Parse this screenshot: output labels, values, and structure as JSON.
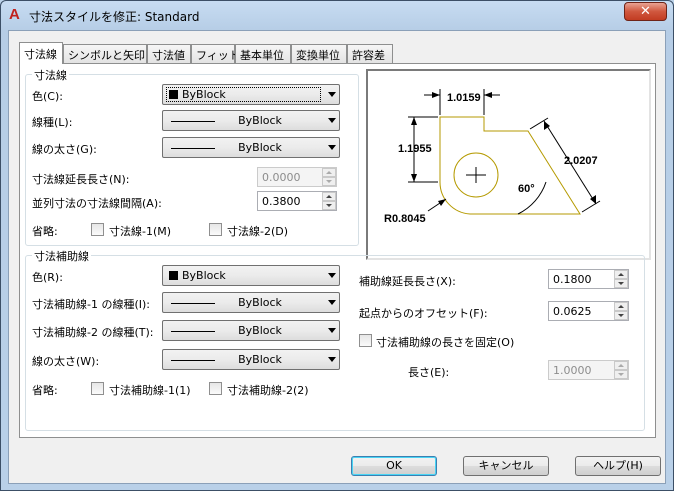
{
  "window": {
    "title": "寸法スタイルを修正: Standard",
    "close_symbol": "✕"
  },
  "tabs": [
    "寸法線",
    "シンボルと矢印",
    "寸法値",
    "フィット",
    "基本単位",
    "変換単位",
    "許容差"
  ],
  "dim_lines": {
    "legend": "寸法線",
    "color_label": "色(C):",
    "color_key": "C",
    "color_value": "ByBlock",
    "linetype_label": "線種(L):",
    "linetype_value": "ByBlock",
    "lineweight_label": "線の太さ(G):",
    "lineweight_value": "ByBlock",
    "extend_label": "寸法線延長長さ(N):",
    "extend_value": "0.0000",
    "baseline_label": "並列寸法の寸法線間隔(A):",
    "baseline_value": "0.3800",
    "suppress_label": "省略:",
    "suppress1_label": "寸法線-1(M)",
    "suppress2_label": "寸法線-2(D)"
  },
  "ext_lines": {
    "legend": "寸法補助線",
    "color_label": "色(R):",
    "color_value": "ByBlock",
    "linetype1_label": "寸法補助線-1 の線種(I):",
    "linetype1_value": "ByBlock",
    "linetype2_label": "寸法補助線-2 の線種(T):",
    "linetype2_value": "ByBlock",
    "lineweight_label": "線の太さ(W):",
    "lineweight_value": "ByBlock",
    "suppress_label": "省略:",
    "suppress1_label": "寸法補助線-1(1)",
    "suppress2_label": "寸法補助線-2(2)",
    "extend_label": "補助線延長長さ(X):",
    "extend_value": "0.1800",
    "offset_label": "起点からのオフセット(F):",
    "offset_value": "0.0625",
    "fixed_label": "寸法補助線の長さを固定(O)",
    "length_label": "長さ(E):",
    "length_value": "1.0000"
  },
  "preview": {
    "dim_top": "1.0159",
    "dim_left": "1.1955",
    "dim_right": "2.0207",
    "dim_angle": "60°",
    "dim_radius": "R0.8045",
    "geometry_color": "#b59a00"
  },
  "buttons": {
    "ok": "OK",
    "cancel": "キャンセル",
    "help": "ヘルプ(H)"
  }
}
